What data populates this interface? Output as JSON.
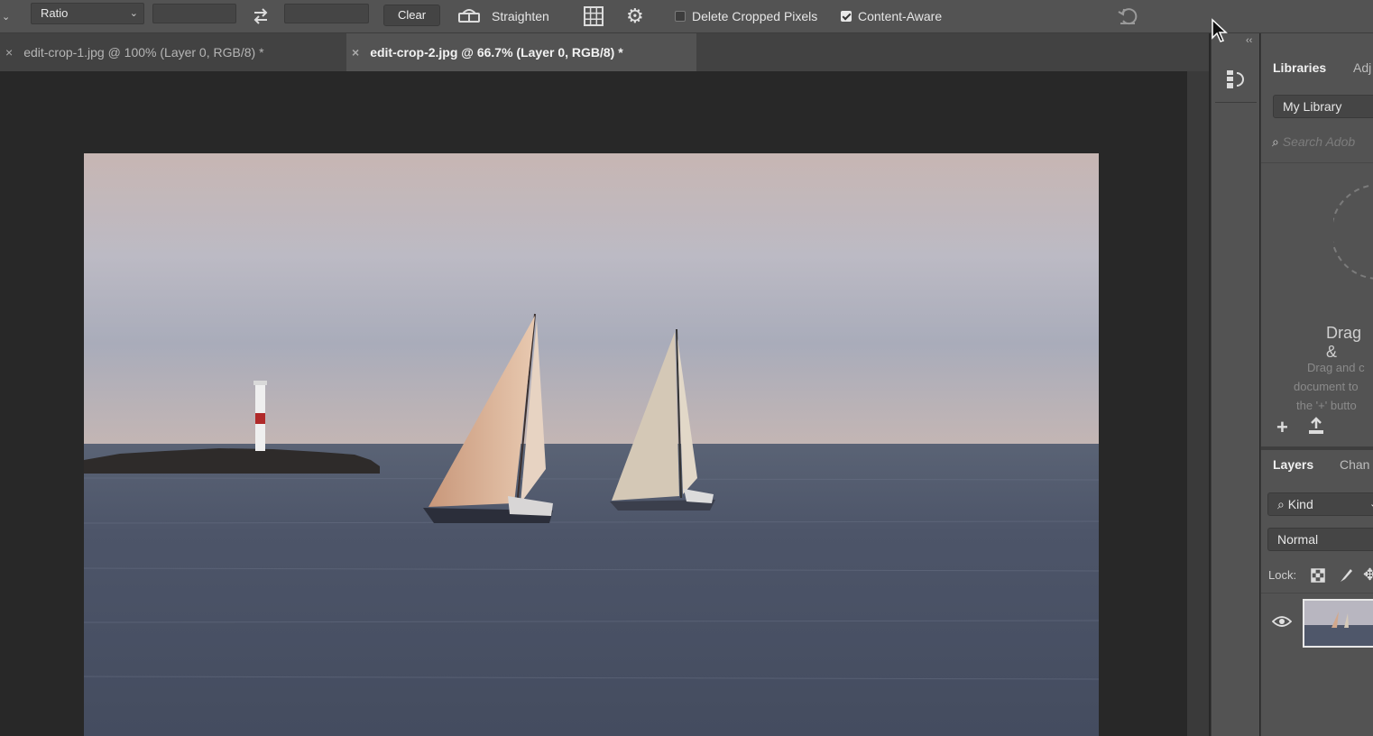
{
  "options_bar": {
    "ratio_label": "Ratio",
    "clear_label": "Clear",
    "straighten_label": "Straighten",
    "delete_cropped_label": "Delete Cropped Pixels",
    "delete_cropped_checked": false,
    "content_aware_label": "Content-Aware",
    "content_aware_checked": true
  },
  "tabs": [
    {
      "close": "×",
      "label": "edit-crop-1.jpg @ 100% (Layer 0, RGB/8) *",
      "active": false
    },
    {
      "close": "×",
      "label": "edit-crop-2.jpg @ 66.7% (Layer 0, RGB/8) *",
      "active": true
    }
  ],
  "libraries_panel": {
    "tab_libraries": "Libraries",
    "tab_adjustments": "Adj",
    "library_select": "My Library",
    "search_placeholder": "Search Adob",
    "drag_title": "Drag &",
    "drag_text": [
      "Drag and c",
      "document to",
      "the '+' butto"
    ]
  },
  "layers_panel": {
    "tab_layers": "Layers",
    "tab_channels": "Chan",
    "filter_kind": "Kind",
    "blend_mode": "Normal",
    "lock_label": "Lock:"
  },
  "colors": {
    "panel_bg": "#535353",
    "canvas_bg": "#282828",
    "tab_bar_bg": "#424242"
  }
}
